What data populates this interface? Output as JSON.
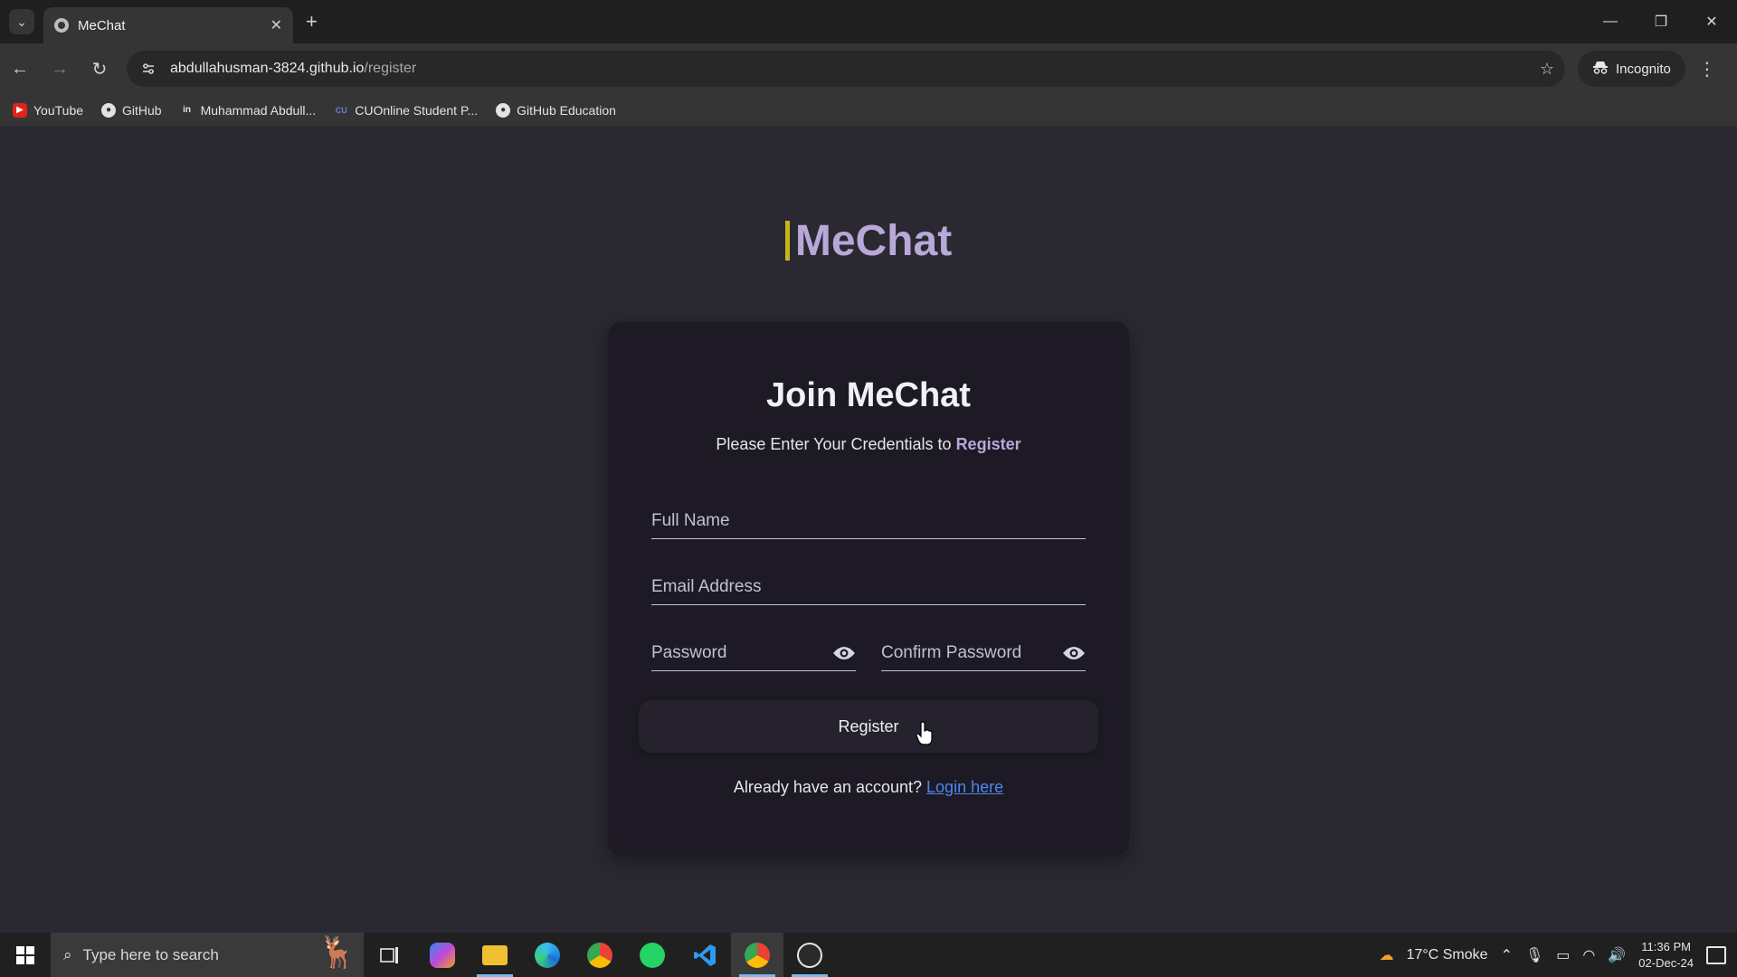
{
  "browser": {
    "tab_title": "MeChat",
    "url_host": "abdullahusman-3824.github.io",
    "url_path": "/register",
    "incognito_label": "Incognito",
    "bookmarks": [
      {
        "label": "YouTube",
        "icon": "youtube-icon"
      },
      {
        "label": "GitHub",
        "icon": "github-icon"
      },
      {
        "label": "Muhammad Abdull...",
        "icon": "linkedin-icon"
      },
      {
        "label": "CUOnline Student P...",
        "icon": "cu-icon"
      },
      {
        "label": "GitHub Education",
        "icon": "github-icon"
      }
    ]
  },
  "page": {
    "brand": "MeChat",
    "card": {
      "title": "Join MeChat",
      "subtitle_prefix": "Please Enter Your Credentials to ",
      "subtitle_strong": "Register",
      "fields": {
        "full_name_placeholder": "Full Name",
        "email_placeholder": "Email Address",
        "password_placeholder": "Password",
        "confirm_password_placeholder": "Confirm Password"
      },
      "register_button": "Register",
      "already_text": "Already have an account? ",
      "login_link": "Login here"
    },
    "colors": {
      "accent": "#b7a8d9",
      "link": "#4d86ef",
      "background": "#2a2830",
      "card": "#1d1a25"
    }
  },
  "taskbar": {
    "search_placeholder": "Type here to search",
    "weather": "17°C  Smoke",
    "time": "11:36 PM",
    "date": "02-Dec-24",
    "apps": [
      "task-view-icon",
      "copilot-icon",
      "file-explorer-icon",
      "edge-icon",
      "chrome-icon",
      "whatsapp-icon",
      "vscode-icon",
      "chrome-incognito-icon",
      "obs-icon"
    ]
  }
}
